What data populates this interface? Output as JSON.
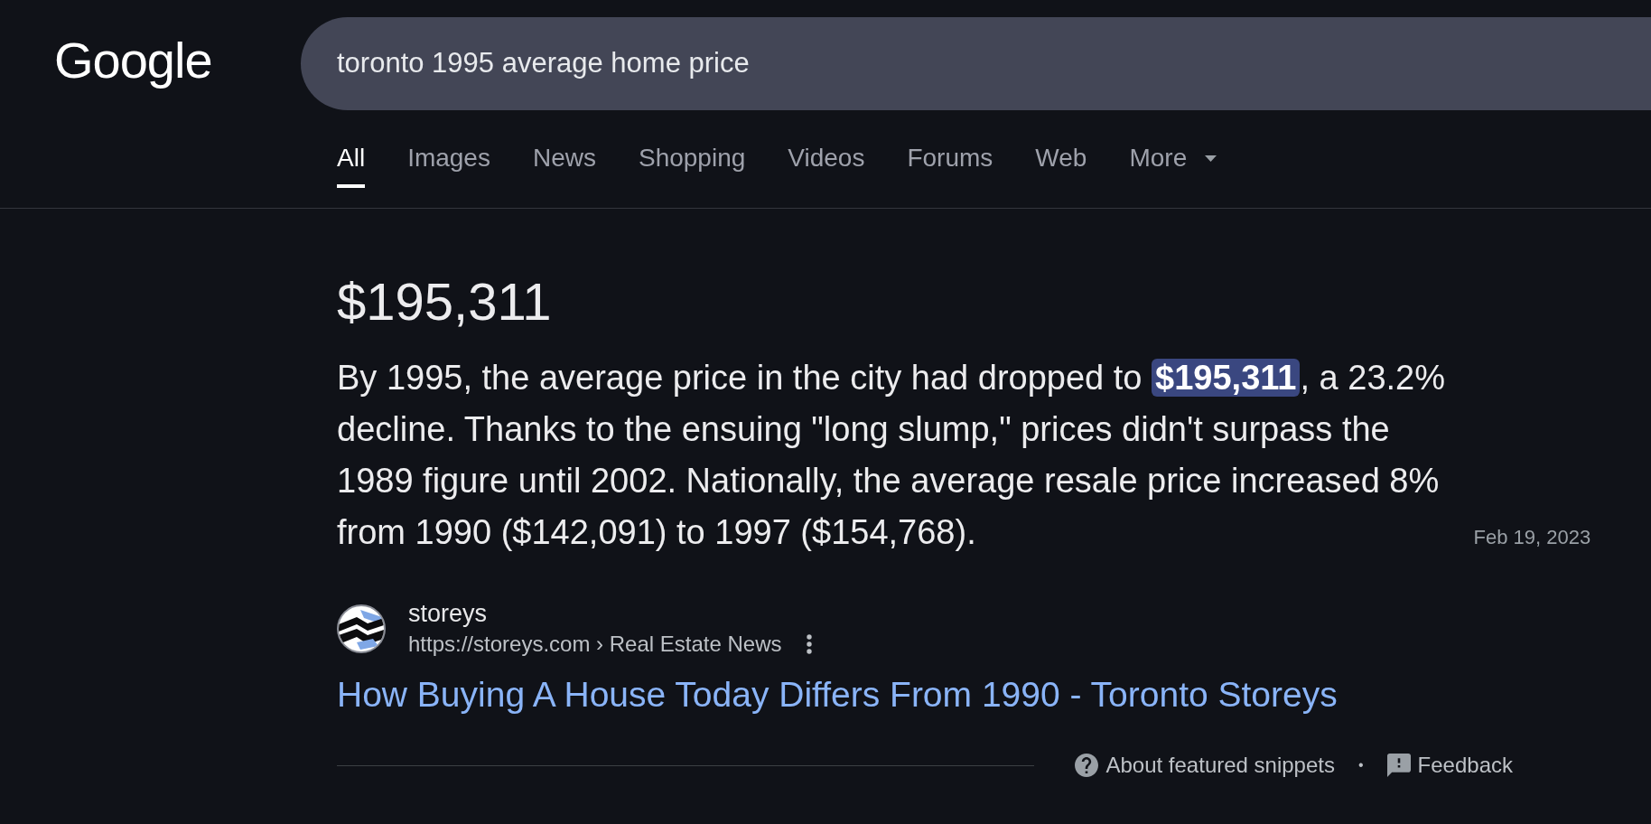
{
  "header": {
    "logo": "Google",
    "search": {
      "value": "toronto 1995 average home price"
    }
  },
  "tabs": [
    {
      "label": "All",
      "selected": true,
      "kind": "link"
    },
    {
      "label": "Images",
      "selected": false,
      "kind": "link"
    },
    {
      "label": "News",
      "selected": false,
      "kind": "link"
    },
    {
      "label": "Shopping",
      "selected": false,
      "kind": "link"
    },
    {
      "label": "Videos",
      "selected": false,
      "kind": "link"
    },
    {
      "label": "Forums",
      "selected": false,
      "kind": "link"
    },
    {
      "label": "Web",
      "selected": false,
      "kind": "link"
    },
    {
      "label": "More",
      "selected": false,
      "kind": "menu"
    }
  ],
  "featured_snippet": {
    "answer": "$195,311",
    "text": "By 1995, the average price in the city had dropped to **$195,311**, a 23.2% decline. Thanks to the ensuing \"long slump,\" prices didn't surpass the 1989 figure until 2002. Nationally, the average resale price increased 8% from 1990 ($142,091) to 1997 ($154,768).",
    "date": "Feb 19, 2023",
    "source": {
      "site_name": "storeys",
      "url": "https://storeys.com › Real Estate News",
      "title": "How Buying A House Today Differs From 1990 - Toronto Storeys"
    }
  },
  "footer": {
    "about": "About featured snippets",
    "separator": "•",
    "feedback": "Feedback"
  }
}
